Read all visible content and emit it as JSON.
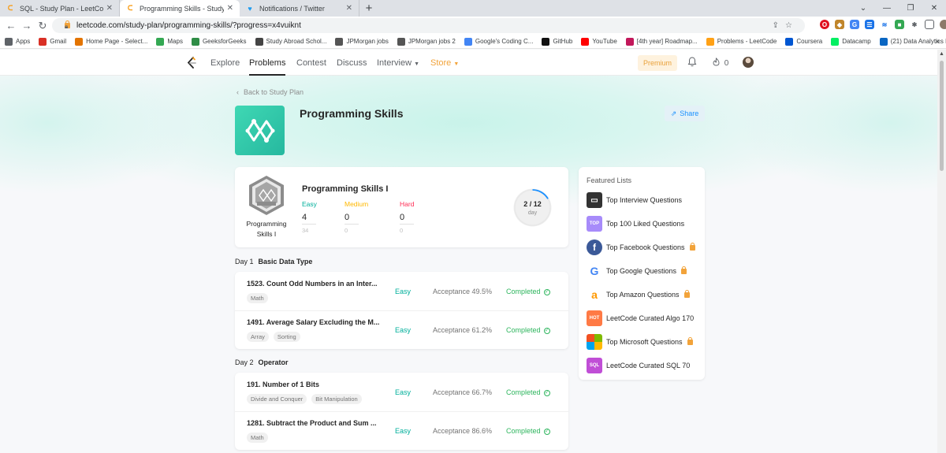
{
  "browser": {
    "tabs": [
      {
        "title": "SQL - Study Plan - LeetCode",
        "favicon": "leetcode-icon"
      },
      {
        "title": "Programming Skills - Study Plan",
        "favicon": "leetcode-icon"
      },
      {
        "title": "Notifications / Twitter",
        "favicon": "twitter-icon"
      }
    ],
    "url": "leetcode.com/study-plan/programming-skills/?progress=x4vuiknt",
    "bookmarks": [
      {
        "label": "Apps",
        "color": "#5f6368"
      },
      {
        "label": "Gmail",
        "color": "#d93025"
      },
      {
        "label": "Home Page - Select...",
        "color": "#e37400"
      },
      {
        "label": "Maps",
        "color": "#34a853"
      },
      {
        "label": "GeeksforGeeks",
        "color": "#2f8d46"
      },
      {
        "label": "Study Abroad Schol...",
        "color": "#444"
      },
      {
        "label": "JPMorgan jobs",
        "color": "#555"
      },
      {
        "label": "JPMorgan jobs 2",
        "color": "#555"
      },
      {
        "label": "Google's Coding C...",
        "color": "#4285f4"
      },
      {
        "label": "GitHub",
        "color": "#111"
      },
      {
        "label": "YouTube",
        "color": "#ff0000"
      },
      {
        "label": "[4th year] Roadmap...",
        "color": "#c2185b"
      },
      {
        "label": "Problems - LeetCode",
        "color": "#ffa116"
      },
      {
        "label": "Coursera",
        "color": "#0056d2"
      },
      {
        "label": "Datacamp",
        "color": "#03ef62"
      },
      {
        "label": "(21) Data Analytics I...",
        "color": "#0a66c2"
      }
    ],
    "bookmarks_more": "»"
  },
  "nav": {
    "items": [
      "Explore",
      "Problems",
      "Contest",
      "Discuss",
      "Interview",
      "Store"
    ],
    "premium": "Premium",
    "streak": "0"
  },
  "plan": {
    "back": "Back to Study Plan",
    "title": "Programming Skills",
    "share": "Share"
  },
  "summary": {
    "badge_label": "Programming Skills I",
    "title": "Programming Skills I",
    "easy_label": "Easy",
    "medium_label": "Medium",
    "hard_label": "Hard",
    "easy_solved": "4",
    "easy_total": "34",
    "medium_solved": "0",
    "medium_total": "0",
    "hard_solved": "0",
    "hard_total": "0",
    "progress_text": "2 / 12",
    "progress_sub": "day",
    "progress_fraction": 0.167,
    "colors": {
      "easy": "#00af9b",
      "medium": "#ffb800",
      "hard": "#ff2d55",
      "ring": "#1a90ff"
    }
  },
  "days": [
    {
      "label": "Day 1",
      "name": "Basic Data Type",
      "problems": [
        {
          "title": "1523. Count Odd Numbers in an Inter...",
          "tags": [
            "Math"
          ],
          "difficulty": "Easy",
          "acceptance": "Acceptance 49.5%",
          "status": "Completed"
        },
        {
          "title": "1491. Average Salary Excluding the M...",
          "tags": [
            "Array",
            "Sorting"
          ],
          "difficulty": "Easy",
          "acceptance": "Acceptance 61.2%",
          "status": "Completed"
        }
      ]
    },
    {
      "label": "Day 2",
      "name": "Operator",
      "problems": [
        {
          "title": "191. Number of 1 Bits",
          "tags": [
            "Divide and Conquer",
            "Bit Manipulation"
          ],
          "difficulty": "Easy",
          "acceptance": "Acceptance 66.7%",
          "status": "Completed"
        },
        {
          "title": "1281. Subtract the Product and Sum ...",
          "tags": [
            "Math"
          ],
          "difficulty": "Easy",
          "acceptance": "Acceptance 86.6%",
          "status": "Completed"
        }
      ]
    }
  ],
  "featured": {
    "heading": "Featured Lists",
    "items": [
      {
        "label": "Top Interview Questions",
        "icon": "laptop-icon",
        "color": "#333333",
        "locked": false
      },
      {
        "label": "Top 100 Liked Questions",
        "icon": "top-icon",
        "color": "#a78bfa",
        "locked": false
      },
      {
        "label": "Top Facebook Questions",
        "icon": "facebook-icon",
        "color": "#3b5998",
        "locked": true
      },
      {
        "label": "Top Google Questions",
        "icon": "google-icon",
        "color": "#4285f4",
        "locked": true
      },
      {
        "label": "Top Amazon Questions",
        "icon": "amazon-icon",
        "color": "#ff9900",
        "locked": true
      },
      {
        "label": "LeetCode Curated Algo 170",
        "icon": "hot-icon",
        "color": "#ff7a45",
        "locked": false
      },
      {
        "label": "Top Microsoft Questions",
        "icon": "microsoft-icon",
        "color": "#00a4ef",
        "locked": true
      },
      {
        "label": "LeetCode Curated SQL 70",
        "icon": "sql-icon",
        "color": "#c04ed6",
        "locked": false
      }
    ]
  }
}
